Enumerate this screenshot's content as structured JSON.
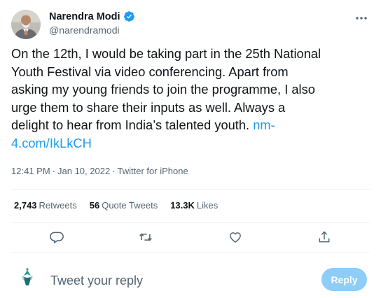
{
  "author": {
    "name": "Narendra Modi",
    "handle": "@narendramodi",
    "verified_color": "#1d9bf0"
  },
  "tweet": {
    "text_lines": [
      "On the 12th, I would be taking part in the 25th National",
      "Youth Festival via video conferencing. Apart from",
      "asking my young friends to join the programme, I also",
      "urge them to share their inputs as well. Always a",
      "delight to hear from India’s talented youth."
    ],
    "link_part1": "nm-",
    "link_part2": "4.com/IkLkCH",
    "link_color": "#1d9bf0"
  },
  "meta": {
    "time": "12:41 PM",
    "date": "Jan 10, 2022",
    "separator": "·",
    "source": "Twitter for iPhone"
  },
  "stats": {
    "retweets_count": "2,743",
    "retweets_label": "Retweets",
    "quotes_count": "56",
    "quotes_label": "Quote Tweets",
    "likes_count": "13.3K",
    "likes_label": "Likes"
  },
  "actions": {
    "icons": [
      "reply-icon",
      "retweet-icon",
      "like-icon",
      "share-icon"
    ]
  },
  "reply_box": {
    "placeholder": "Tweet your reply",
    "button_label": "Reply",
    "button_color": "#8ecdf8"
  }
}
